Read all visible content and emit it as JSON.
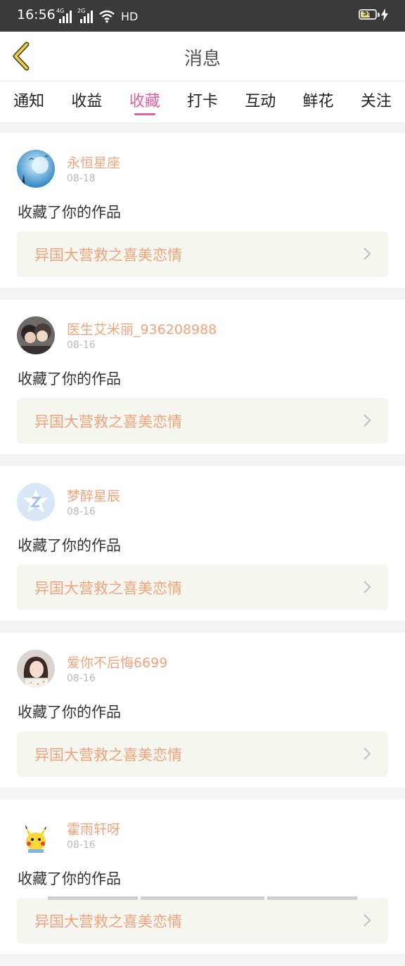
{
  "status_bar": {
    "time": "16:56",
    "network_1": "4G",
    "network_2": "2G",
    "hd_label": "HD",
    "battery_level": "59",
    "icons": [
      "signal-icon",
      "wifi-icon",
      "battery-icon",
      "charging-icon"
    ]
  },
  "header": {
    "title": "消息"
  },
  "tabs": [
    {
      "label": "通知"
    },
    {
      "label": "收益"
    },
    {
      "label": "收藏",
      "active": true
    },
    {
      "label": "打卡"
    },
    {
      "label": "互动"
    },
    {
      "label": "鲜花"
    },
    {
      "label": "关注"
    }
  ],
  "colors": {
    "accent_pink": "#e3609b",
    "username_orange": "#f0a27a",
    "back_arrow_yellow": "#f2cf3b"
  },
  "messages": [
    {
      "username": "永恒星座",
      "date": "08-18",
      "action": "收藏了你的作品",
      "work_title": "异国大营救之喜美恋情"
    },
    {
      "username": "医生艾米丽_936208988",
      "date": "08-16",
      "action": "收藏了你的作品",
      "work_title": "异国大营救之喜美恋情"
    },
    {
      "username": "梦醉星辰",
      "date": "08-16",
      "action": "收藏了你的作品",
      "work_title": "异国大营救之喜美恋情"
    },
    {
      "username": "爱你不后悔6699",
      "date": "08-16",
      "action": "收藏了你的作品",
      "work_title": "异国大营救之喜美恋情"
    },
    {
      "username": "霍雨轩呀",
      "date": "08-16",
      "action": "收藏了你的作品",
      "work_title": "异国大营救之喜美恋情"
    }
  ]
}
